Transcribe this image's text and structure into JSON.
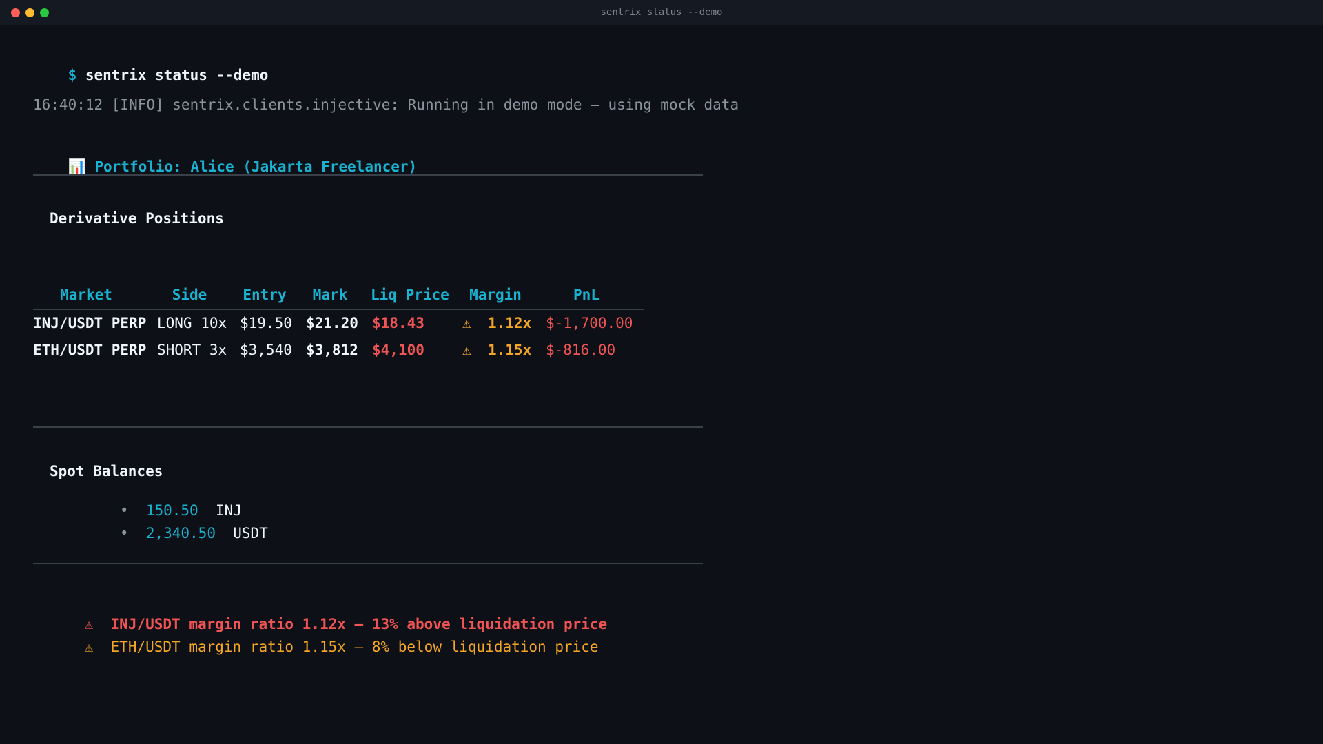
{
  "window": {
    "title": "sentrix status --demo"
  },
  "prompt": {
    "symbol": "$",
    "command": "sentrix status --demo"
  },
  "log": {
    "line": "16:40:12 [INFO] sentrix.clients.injective: Running in demo mode — using mock data"
  },
  "portfolio": {
    "icon": "📊",
    "label": "Portfolio: Alice (Jakarta Freelancer)"
  },
  "derivatives": {
    "title": "Derivative Positions",
    "headers": [
      "Market",
      "Side",
      "Entry",
      "Mark",
      "Liq Price",
      "Margin",
      "PnL"
    ],
    "rows": [
      {
        "market": "INJ/USDT PERP",
        "side": "LONG 10x",
        "entry": "$19.50",
        "mark": "$21.20",
        "liq": "$18.43",
        "warn": "⚠",
        "margin": "1.12x",
        "pnl": "$-1,700.00"
      },
      {
        "market": "ETH/USDT PERP",
        "side": "SHORT 3x",
        "entry": "$3,540",
        "mark": "$3,812",
        "liq": "$4,100",
        "warn": "⚠",
        "margin": "1.15x",
        "pnl": "$-816.00"
      }
    ]
  },
  "spot": {
    "title": "Spot Balances",
    "bullet": "•",
    "items": [
      {
        "amount": "150.50",
        "asset": "INJ"
      },
      {
        "amount": "2,340.50",
        "asset": "USDT"
      }
    ]
  },
  "alerts": [
    {
      "icon": "⚠",
      "text": "INJ/USDT margin ratio 1.12x — 13% above liquidation price",
      "color": "#f05454"
    },
    {
      "icon": "⚠",
      "text": "ETH/USDT margin ratio 1.15x — 8% below liquidation price",
      "color": "#f5a623"
    }
  ],
  "colors": {
    "accent": "#19b3d1",
    "danger": "#f05454",
    "warning": "#f5a623",
    "background": "#0d1117"
  }
}
